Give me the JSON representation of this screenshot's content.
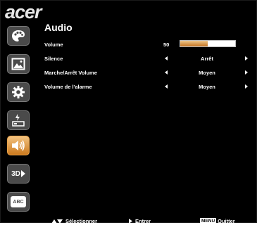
{
  "brand": {
    "logo_text": "acer"
  },
  "sidebar": {
    "items": [
      {
        "name": "color",
        "icon": "palette-icon",
        "active": false
      },
      {
        "name": "image",
        "icon": "picture-icon",
        "active": false
      },
      {
        "name": "settings",
        "icon": "gear-icon",
        "active": false
      },
      {
        "name": "power",
        "icon": "power-info-icon",
        "active": false
      },
      {
        "name": "audio",
        "icon": "speaker-icon",
        "active": true
      },
      {
        "name": "3d",
        "icon": "3d-icon",
        "label": "3D",
        "active": false
      },
      {
        "name": "language",
        "icon": "abc-icon",
        "label": "ABC",
        "active": false
      }
    ]
  },
  "main": {
    "title": "Audio",
    "volume": {
      "label": "Volume",
      "value": "50",
      "level_percent": 50
    },
    "options": [
      {
        "label": "Silence",
        "value": "Arrêt"
      },
      {
        "label": "Marche/Arrêt Volume",
        "value": "Moyen"
      },
      {
        "label": "Volume de l'alarme",
        "value": "Moyen"
      }
    ]
  },
  "footer": {
    "select_label": "Sélectionner",
    "enter_label": "Entrer",
    "menu_key": "MENU",
    "quit_label": "Quitter"
  },
  "colors": {
    "background": "#000000",
    "text": "#ffffff",
    "accent": "#e8a24a",
    "sidebar_button": "#4a4a4a"
  }
}
